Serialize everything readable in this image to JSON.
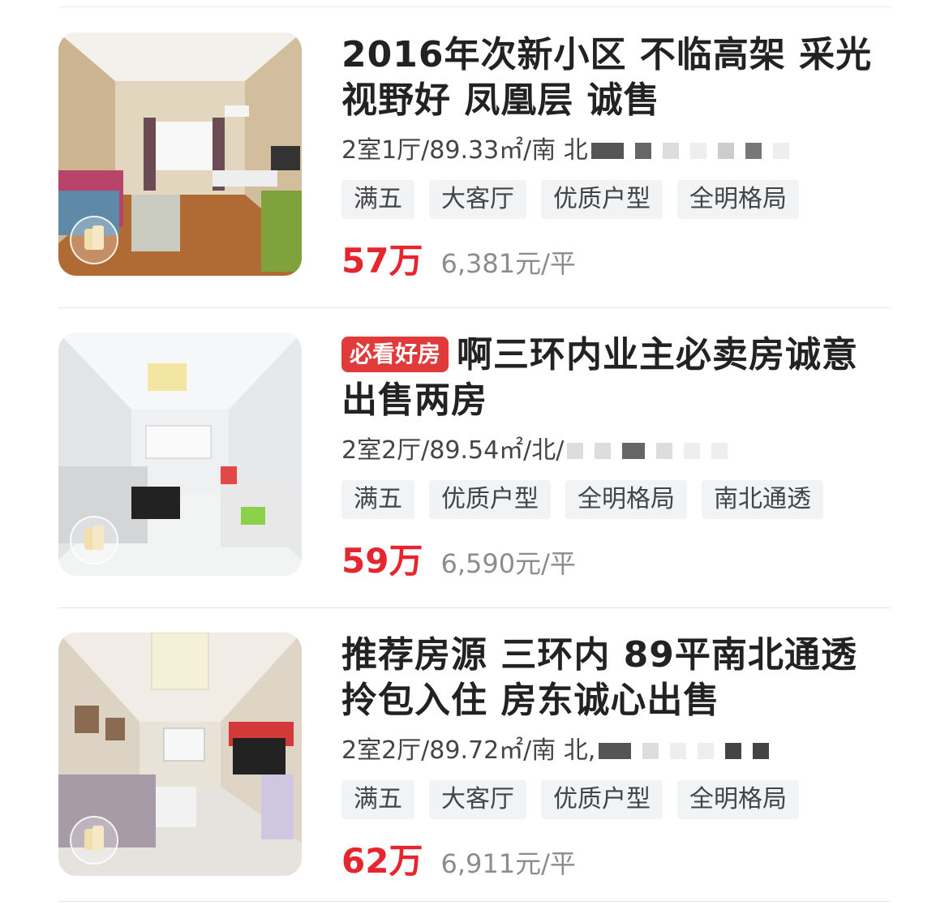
{
  "listings": [
    {
      "title": "2016年次新小区 不临高架 采光视野好 凤凰层 诚售",
      "hot_badge": "",
      "specs": "2室1厅/89.33㎡/南 北",
      "tags": [
        "满五",
        "大客厅",
        "优质户型",
        "全明格局"
      ],
      "price": "57万",
      "unit_price": "6,381元/平"
    },
    {
      "title": "啊三环内业主必卖房诚意出售两房",
      "hot_badge": "必看好房",
      "specs": "2室2厅/89.54㎡/北/",
      "tags": [
        "满五",
        "优质户型",
        "全明格局",
        "南北通透"
      ],
      "price": "59万",
      "unit_price": "6,590元/平"
    },
    {
      "title": "推荐房源 三环内 89平南北通透 拎包入住 房东诚心出售",
      "hot_badge": "",
      "specs": "2室2厅/89.72㎡/南 北,",
      "tags": [
        "满五",
        "大客厅",
        "优质户型",
        "全明格局"
      ],
      "price": "62万",
      "unit_price": "6,911元/平"
    }
  ],
  "colors": {
    "price": "#e5262e",
    "hot_badge": "#e03a3a",
    "tag_bg": "#f2f3f5",
    "unit_price": "#8c8c8c"
  }
}
